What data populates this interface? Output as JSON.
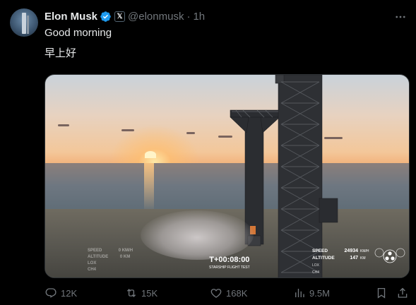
{
  "author": {
    "name": "Elon Musk",
    "handle": "@elonmusk",
    "separator": "·",
    "time": "1h",
    "affiliate_badge": "𝕏"
  },
  "post": {
    "line1": "Good morning",
    "line2": "早上好"
  },
  "media_overlay": {
    "left_labels": [
      "SPEED",
      "ALTITUDE",
      "LOX",
      "CH4"
    ],
    "left_values": [
      "0 KM/H",
      "0 KM"
    ],
    "timer": "T+00:08:00",
    "subtitle": "STARSHIP FLIGHT TEST",
    "speed_label": "SPEED",
    "speed_value": "24934",
    "speed_unit": "KM/H",
    "altitude_label": "ALTITUDE",
    "altitude_value": "147",
    "altitude_unit": "KM",
    "lox_label": "LOX",
    "ch4_label": "CH4"
  },
  "actions": {
    "replies": "12K",
    "reposts": "15K",
    "likes": "168K",
    "views": "9.5M"
  },
  "colors": {
    "background": "#000000",
    "text_primary": "#e7e9ea",
    "text_secondary": "#71767b",
    "verified": "#1d9bf0"
  },
  "icons": [
    "more-icon",
    "verified-badge-icon",
    "reply-icon",
    "repost-icon",
    "like-icon",
    "views-icon",
    "bookmark-icon",
    "share-icon"
  ]
}
